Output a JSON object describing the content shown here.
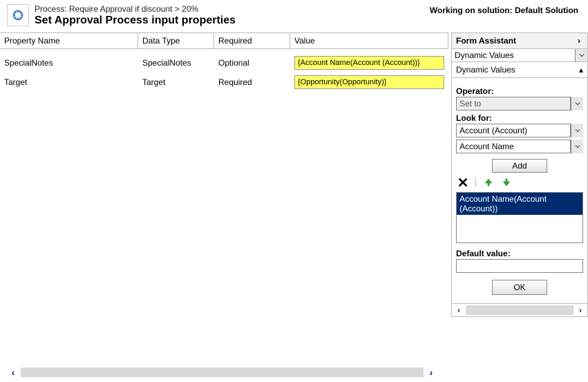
{
  "header": {
    "process": "Process: Require Approval if discount > 20%",
    "title": "Set Approval Process input properties",
    "solution": "Working on solution: Default Solution"
  },
  "columns": {
    "name": "Property Name",
    "type": "Data Type",
    "required": "Required",
    "value": "Value"
  },
  "rows": [
    {
      "name": "SpecialNotes",
      "type": "SpecialNotes",
      "required": "Optional",
      "value": "{Account Name(Account (Account))}"
    },
    {
      "name": "Target",
      "type": "Target",
      "required": "Required",
      "value": "{Opportunity(Opportunity)}"
    }
  ],
  "assist": {
    "hdr": "Form Assistant",
    "mode": "Dynamic Values",
    "section": "Dynamic Values",
    "operator_label": "Operator:",
    "operator_value": "Set to",
    "lookfor_label": "Look for:",
    "lookfor_entity": "Account (Account)",
    "lookfor_attr": "Account Name",
    "add": "Add",
    "list_item": "Account Name(Account (Account))",
    "default_label": "Default value:",
    "default_value": "",
    "ok": "OK"
  }
}
